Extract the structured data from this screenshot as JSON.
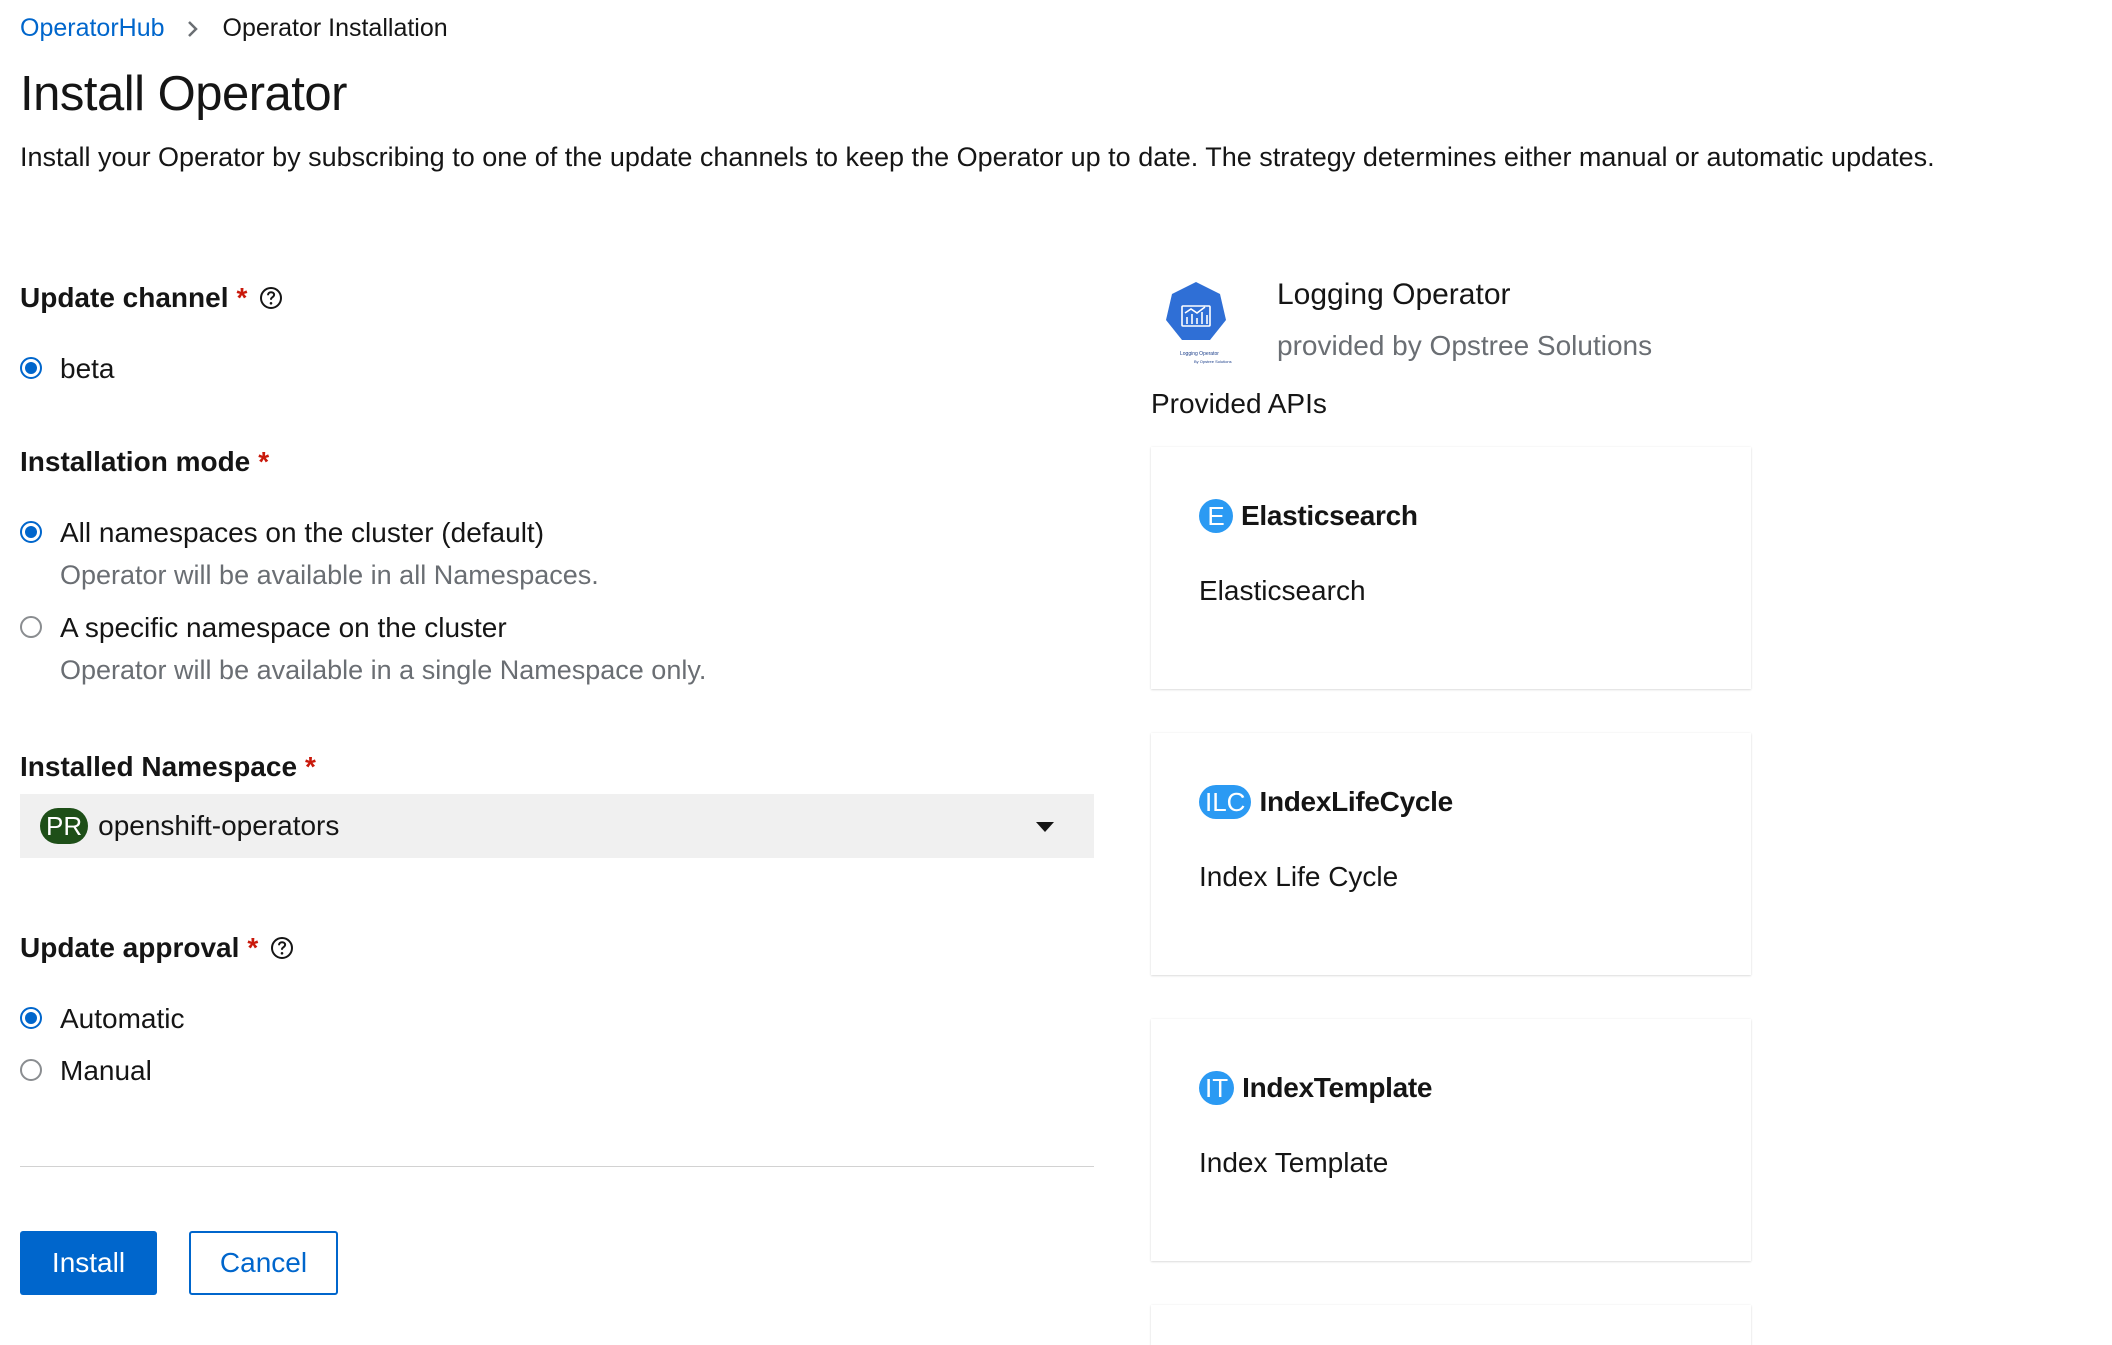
{
  "breadcrumb": {
    "parent": "OperatorHub",
    "current": "Operator Installation"
  },
  "page": {
    "title": "Install Operator",
    "description": "Install your Operator by subscribing to one of the update channels to keep the Operator up to date. The strategy determines either manual or automatic updates."
  },
  "form": {
    "update_channel": {
      "label": "Update channel",
      "required_mark": "*",
      "options": [
        {
          "label": "beta",
          "checked": true
        }
      ]
    },
    "installation_mode": {
      "label": "Installation mode",
      "required_mark": "*",
      "options": [
        {
          "label": "All namespaces on the cluster (default)",
          "description": "Operator will be available in all Namespaces.",
          "checked": true
        },
        {
          "label": "A specific namespace on the cluster",
          "description": "Operator will be available in a single Namespace only.",
          "checked": false
        }
      ]
    },
    "installed_namespace": {
      "label": "Installed Namespace",
      "required_mark": "*",
      "badge": "PR",
      "value": "openshift-operators"
    },
    "update_approval": {
      "label": "Update approval",
      "required_mark": "*",
      "options": [
        {
          "label": "Automatic",
          "checked": true
        },
        {
          "label": "Manual",
          "checked": false
        }
      ]
    }
  },
  "actions": {
    "install": "Install",
    "cancel": "Cancel"
  },
  "operator": {
    "name": "Logging Operator",
    "provider": "provided by Opstree Solutions",
    "logo_caption": "Logging Operator",
    "logo_subcaption": "By Opstree Solutions"
  },
  "provided_apis": {
    "heading": "Provided APIs",
    "items": [
      {
        "badge": "E",
        "name": "Elasticsearch",
        "description": "Elasticsearch"
      },
      {
        "badge": "ILC",
        "name": "IndexLifeCycle",
        "description": "Index Life Cycle"
      },
      {
        "badge": "IT",
        "name": "IndexTemplate",
        "description": "Index Template"
      }
    ]
  },
  "colors": {
    "link": "#0066cc",
    "primary": "#0066cc",
    "required": "#c9190b",
    "namespace_badge": "#1e4f18",
    "api_badge": "#2b9af3",
    "operator_logo": "#2f6fd6"
  },
  "icons": {
    "breadcrumb_separator": "chevron-right-icon",
    "help": "question-circle-icon",
    "dropdown": "caret-down-icon"
  }
}
